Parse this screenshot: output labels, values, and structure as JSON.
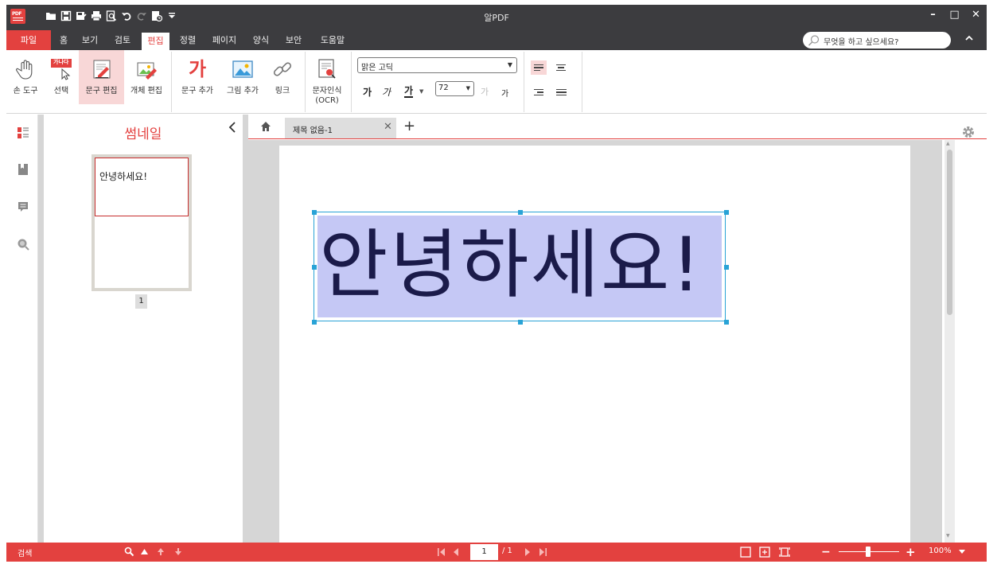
{
  "app": {
    "title": "알PDF"
  },
  "window_controls": {
    "minimize": "–",
    "maximize": "□",
    "close": "✕"
  },
  "menu": {
    "file": "파일",
    "items": [
      "홈",
      "보기",
      "검토",
      "편집",
      "정렬",
      "페이지",
      "양식",
      "보안",
      "도움말"
    ],
    "active": "편집",
    "search_placeholder": "무엇을 하고 싶으세요?"
  },
  "ribbon": {
    "hand_tool": "손 도구",
    "select": "선택",
    "select_badge": "가나다",
    "edit_text": "문구 편집",
    "edit_object": "개체 편집",
    "add_text": "문구 추가",
    "add_text_glyph": "가",
    "add_image": "그림 추가",
    "link": "링크",
    "ocr_line1": "문자인식",
    "ocr_line2": "(OCR)",
    "font_name": "맑은 고딕",
    "font_size": "72",
    "bold_glyph": "가",
    "italic_glyph": "가",
    "underline_glyph": "가",
    "grow_glyph": "가",
    "shrink_glyph": "가"
  },
  "thumbnail_panel": {
    "title": "썸네일",
    "page_text": "안녕하세요!",
    "page_number": "1"
  },
  "tabs": {
    "doc_title": "제목 없음-1"
  },
  "document": {
    "text": "안녕하세요!"
  },
  "statusbar": {
    "search_label": "검색",
    "current_page": "1",
    "total_pages": "/ 1",
    "zoom": "100%",
    "zoom_fraction": 0.5
  },
  "colors": {
    "accent": "#e3413f",
    "titlebar": "#3c3c3f",
    "selection": "#c5c8f5",
    "handle": "#29a3d6"
  }
}
